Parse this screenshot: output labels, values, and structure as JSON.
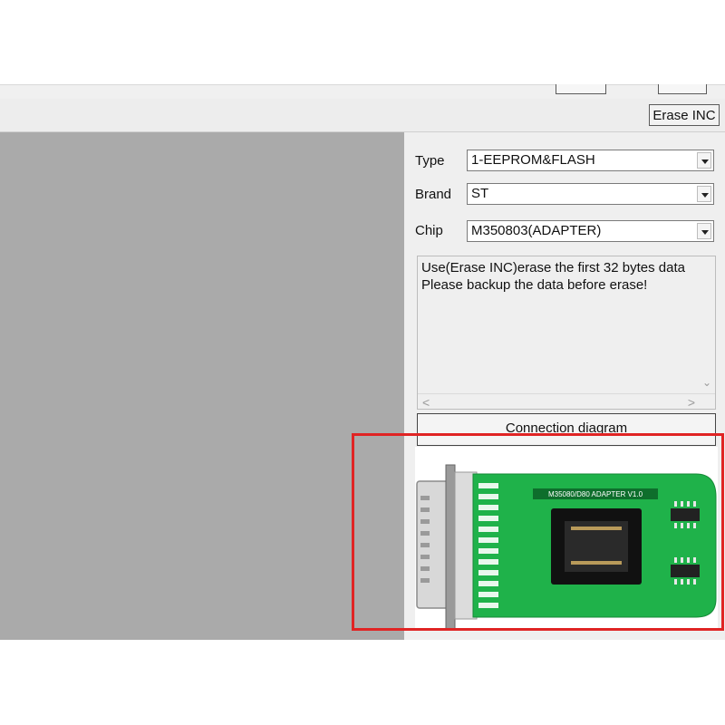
{
  "toolbar": {
    "erase_label": "Erase INC"
  },
  "panel": {
    "type_label": "Type",
    "type_value": "1-EEPROM&FLASH",
    "brand_label": "Brand",
    "brand_value": "ST",
    "chip_label": "Chip",
    "chip_value": "M350803(ADAPTER)",
    "message_lines": [
      "Use(Erase INC)erase the first 32 bytes data",
      "Please backup the data before erase!"
    ],
    "connection_label": "Connection diagram"
  },
  "diagram": {
    "board_label": "M35080/D80 ADAPTER V1.0",
    "board_color": "#1fb24a",
    "highlight_color": "#e02424"
  }
}
